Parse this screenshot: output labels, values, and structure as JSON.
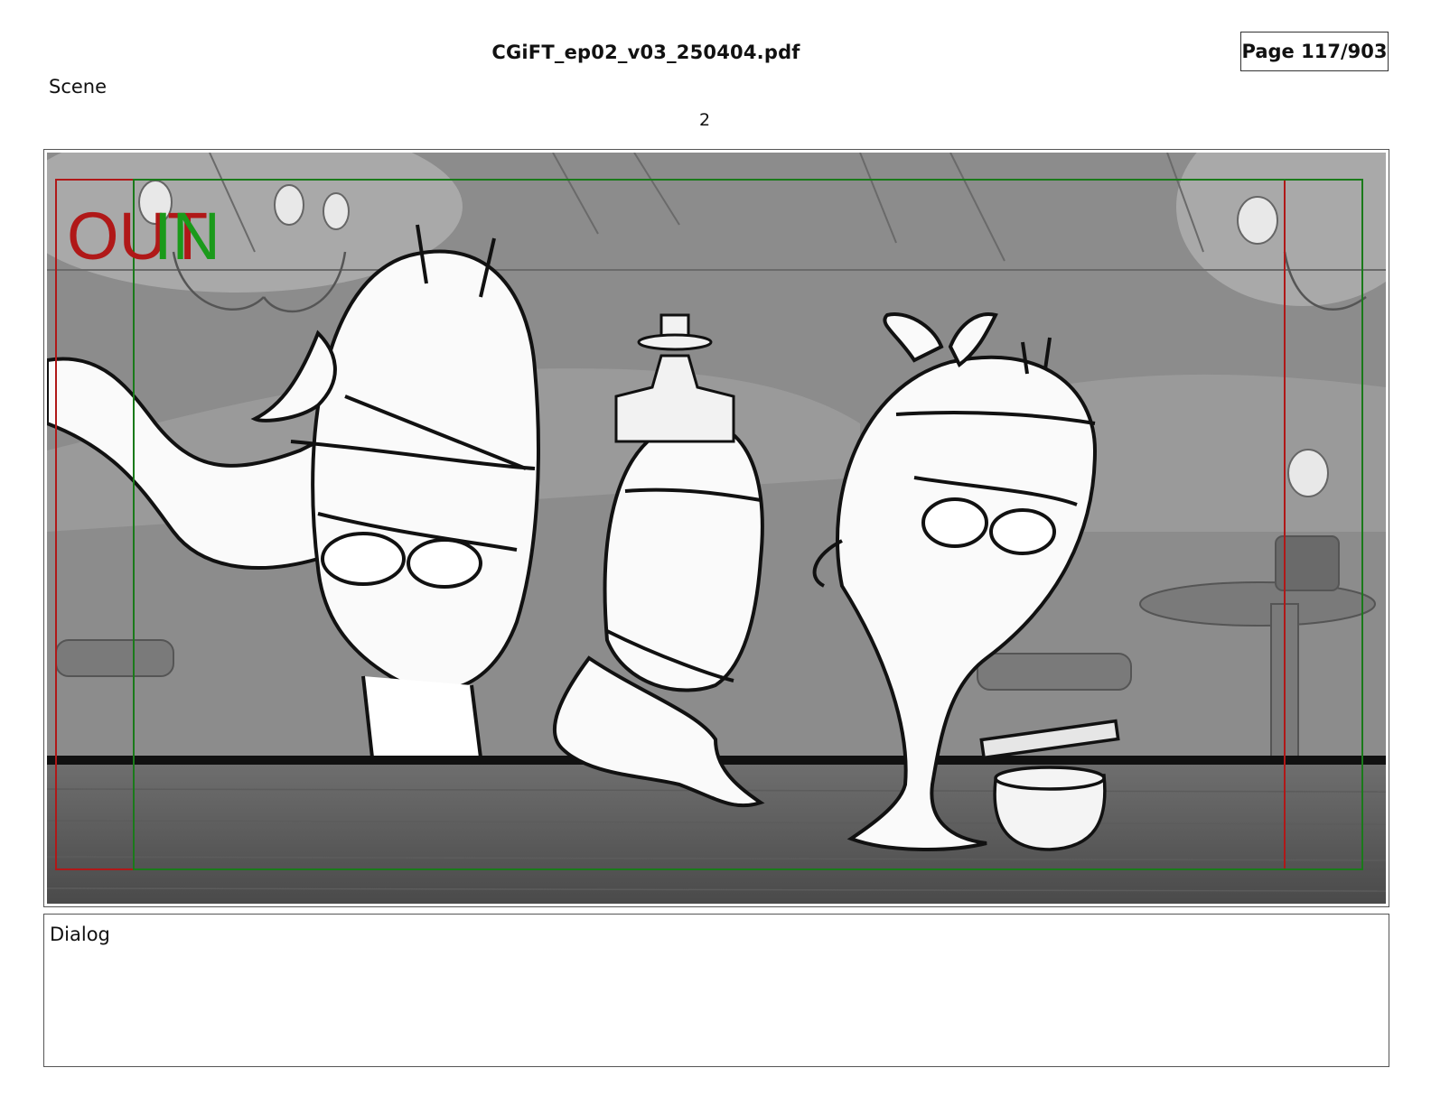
{
  "header": {
    "file_name": "CGiFT_ep02_v03_250404.pdf",
    "page_indicator": "Page 117/903"
  },
  "scene": {
    "label": "Scene",
    "number": "2"
  },
  "panel": {
    "out_marker": "OUT",
    "in_marker": "IN",
    "colors": {
      "out_frame": "#b01818",
      "in_frame": "#1a7a1a"
    }
  },
  "dialog": {
    "label": "Dialog",
    "text": ""
  }
}
